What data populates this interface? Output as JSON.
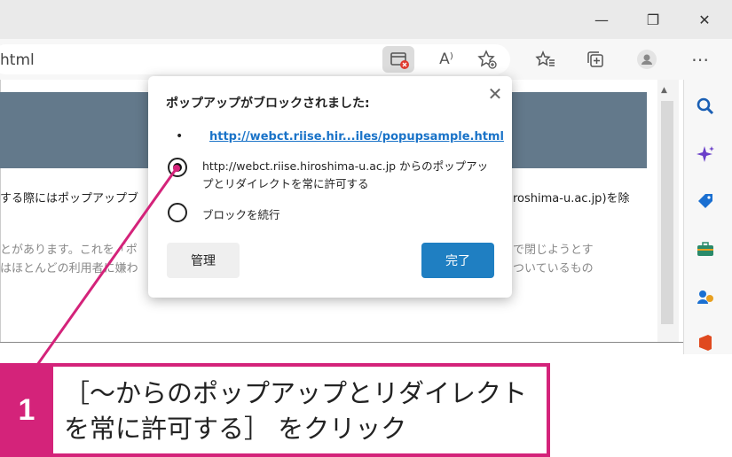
{
  "window": {
    "minimize": "—",
    "restore": "❐",
    "close": "✕"
  },
  "toolbar": {
    "url": "html",
    "read_aloud": "A⁾",
    "more": "⋯"
  },
  "page": {
    "line1_left": "する際にはポップアップブ",
    "line1_right": "roshima-u.ac.jp)を除",
    "line2_left": "とがあります。これを「ポ",
    "line2_right": "で閉じようとす",
    "line3_left": "はほとんどの利用者に嫌わ",
    "line3_right": "ついているもの"
  },
  "dialog": {
    "title": "ポップアップがブロックされました:",
    "bullet": "•",
    "link": "http://webct.riise.hir...iles/popupsample.html",
    "option_allow": "http://webct.riise.hiroshima-u.ac.jp からのポップアップとリダイレクトを常に許可する",
    "option_block": "ブロックを続行",
    "manage_label": "管理",
    "done_label": "完了",
    "close": "✕"
  },
  "callout": {
    "number": "1",
    "text": "［～からのポップアップとリダイレクトを常に許可する］ をクリック"
  },
  "colors": {
    "accent": "#d4237a",
    "primary": "#1f7fc2",
    "banner": "#63798b"
  }
}
